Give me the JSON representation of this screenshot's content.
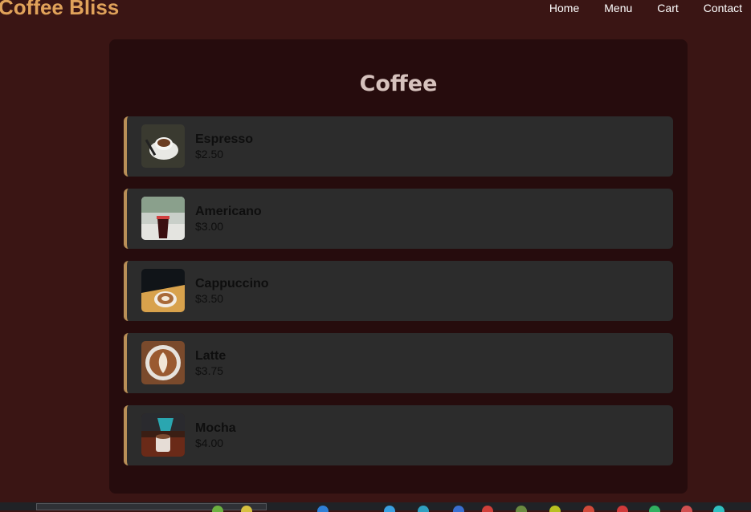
{
  "header": {
    "brand": "Coffee Bliss",
    "nav": [
      "Home",
      "Menu",
      "Cart",
      "Contact"
    ]
  },
  "menu": {
    "title": "Coffee",
    "items": [
      {
        "name": "Espresso",
        "price": "$2.50"
      },
      {
        "name": "Americano",
        "price": "$3.00"
      },
      {
        "name": "Cappuccino",
        "price": "$3.50"
      },
      {
        "name": "Latte",
        "price": "$3.75"
      },
      {
        "name": "Mocha",
        "price": "$4.00"
      }
    ]
  },
  "colors": {
    "page_bg": "#3a1514",
    "panel_bg": "#260c0d",
    "card_bg": "#2c2c2c",
    "card_accent": "#b98f57",
    "brand": "#e0a25a",
    "title": "#d6c2bd"
  }
}
